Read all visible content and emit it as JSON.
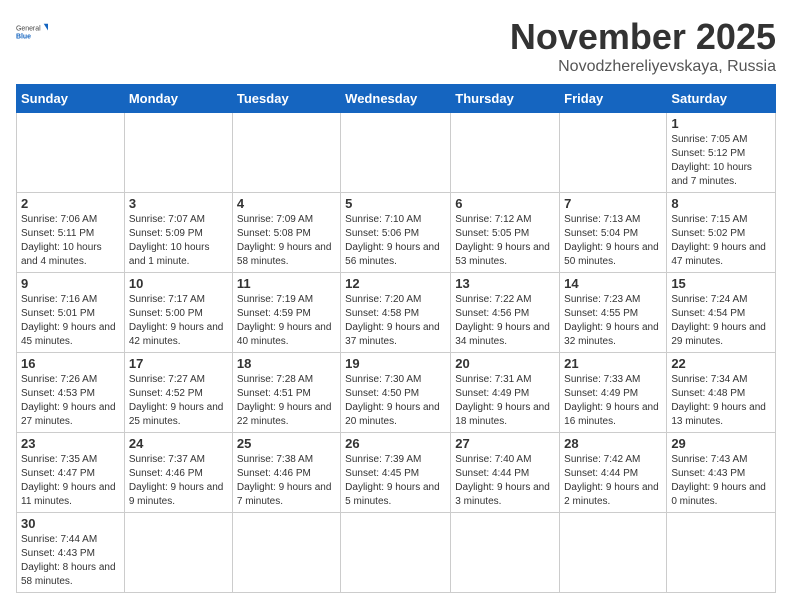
{
  "logo": {
    "general": "General",
    "blue": "Blue"
  },
  "title": "November 2025",
  "location": "Novodzhereliyevskaya, Russia",
  "days_of_week": [
    "Sunday",
    "Monday",
    "Tuesday",
    "Wednesday",
    "Thursday",
    "Friday",
    "Saturday"
  ],
  "weeks": [
    [
      {
        "day": "",
        "info": ""
      },
      {
        "day": "",
        "info": ""
      },
      {
        "day": "",
        "info": ""
      },
      {
        "day": "",
        "info": ""
      },
      {
        "day": "",
        "info": ""
      },
      {
        "day": "",
        "info": ""
      },
      {
        "day": "1",
        "info": "Sunrise: 7:05 AM\nSunset: 5:12 PM\nDaylight: 10 hours and 7 minutes."
      }
    ],
    [
      {
        "day": "2",
        "info": "Sunrise: 7:06 AM\nSunset: 5:11 PM\nDaylight: 10 hours and 4 minutes."
      },
      {
        "day": "3",
        "info": "Sunrise: 7:07 AM\nSunset: 5:09 PM\nDaylight: 10 hours and 1 minute."
      },
      {
        "day": "4",
        "info": "Sunrise: 7:09 AM\nSunset: 5:08 PM\nDaylight: 9 hours and 58 minutes."
      },
      {
        "day": "5",
        "info": "Sunrise: 7:10 AM\nSunset: 5:06 PM\nDaylight: 9 hours and 56 minutes."
      },
      {
        "day": "6",
        "info": "Sunrise: 7:12 AM\nSunset: 5:05 PM\nDaylight: 9 hours and 53 minutes."
      },
      {
        "day": "7",
        "info": "Sunrise: 7:13 AM\nSunset: 5:04 PM\nDaylight: 9 hours and 50 minutes."
      },
      {
        "day": "8",
        "info": "Sunrise: 7:15 AM\nSunset: 5:02 PM\nDaylight: 9 hours and 47 minutes."
      }
    ],
    [
      {
        "day": "9",
        "info": "Sunrise: 7:16 AM\nSunset: 5:01 PM\nDaylight: 9 hours and 45 minutes."
      },
      {
        "day": "10",
        "info": "Sunrise: 7:17 AM\nSunset: 5:00 PM\nDaylight: 9 hours and 42 minutes."
      },
      {
        "day": "11",
        "info": "Sunrise: 7:19 AM\nSunset: 4:59 PM\nDaylight: 9 hours and 40 minutes."
      },
      {
        "day": "12",
        "info": "Sunrise: 7:20 AM\nSunset: 4:58 PM\nDaylight: 9 hours and 37 minutes."
      },
      {
        "day": "13",
        "info": "Sunrise: 7:22 AM\nSunset: 4:56 PM\nDaylight: 9 hours and 34 minutes."
      },
      {
        "day": "14",
        "info": "Sunrise: 7:23 AM\nSunset: 4:55 PM\nDaylight: 9 hours and 32 minutes."
      },
      {
        "day": "15",
        "info": "Sunrise: 7:24 AM\nSunset: 4:54 PM\nDaylight: 9 hours and 29 minutes."
      }
    ],
    [
      {
        "day": "16",
        "info": "Sunrise: 7:26 AM\nSunset: 4:53 PM\nDaylight: 9 hours and 27 minutes."
      },
      {
        "day": "17",
        "info": "Sunrise: 7:27 AM\nSunset: 4:52 PM\nDaylight: 9 hours and 25 minutes."
      },
      {
        "day": "18",
        "info": "Sunrise: 7:28 AM\nSunset: 4:51 PM\nDaylight: 9 hours and 22 minutes."
      },
      {
        "day": "19",
        "info": "Sunrise: 7:30 AM\nSunset: 4:50 PM\nDaylight: 9 hours and 20 minutes."
      },
      {
        "day": "20",
        "info": "Sunrise: 7:31 AM\nSunset: 4:49 PM\nDaylight: 9 hours and 18 minutes."
      },
      {
        "day": "21",
        "info": "Sunrise: 7:33 AM\nSunset: 4:49 PM\nDaylight: 9 hours and 16 minutes."
      },
      {
        "day": "22",
        "info": "Sunrise: 7:34 AM\nSunset: 4:48 PM\nDaylight: 9 hours and 13 minutes."
      }
    ],
    [
      {
        "day": "23",
        "info": "Sunrise: 7:35 AM\nSunset: 4:47 PM\nDaylight: 9 hours and 11 minutes."
      },
      {
        "day": "24",
        "info": "Sunrise: 7:37 AM\nSunset: 4:46 PM\nDaylight: 9 hours and 9 minutes."
      },
      {
        "day": "25",
        "info": "Sunrise: 7:38 AM\nSunset: 4:46 PM\nDaylight: 9 hours and 7 minutes."
      },
      {
        "day": "26",
        "info": "Sunrise: 7:39 AM\nSunset: 4:45 PM\nDaylight: 9 hours and 5 minutes."
      },
      {
        "day": "27",
        "info": "Sunrise: 7:40 AM\nSunset: 4:44 PM\nDaylight: 9 hours and 3 minutes."
      },
      {
        "day": "28",
        "info": "Sunrise: 7:42 AM\nSunset: 4:44 PM\nDaylight: 9 hours and 2 minutes."
      },
      {
        "day": "29",
        "info": "Sunrise: 7:43 AM\nSunset: 4:43 PM\nDaylight: 9 hours and 0 minutes."
      }
    ],
    [
      {
        "day": "30",
        "info": "Sunrise: 7:44 AM\nSunset: 4:43 PM\nDaylight: 8 hours and 58 minutes."
      },
      {
        "day": "",
        "info": ""
      },
      {
        "day": "",
        "info": ""
      },
      {
        "day": "",
        "info": ""
      },
      {
        "day": "",
        "info": ""
      },
      {
        "day": "",
        "info": ""
      },
      {
        "day": "",
        "info": ""
      }
    ]
  ]
}
